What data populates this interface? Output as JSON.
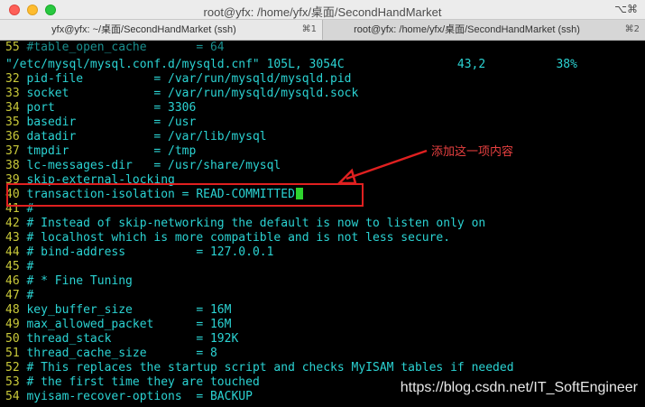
{
  "window": {
    "title": "root@yfx: /home/yfx/桌面/SecondHandMarket",
    "right_shortcut": "⌥⌘"
  },
  "tabs": [
    {
      "label": "yfx@yfx: ~/桌面/SecondHandMarket (ssh)",
      "shortcut": "⌘1",
      "active": true
    },
    {
      "label": "root@yfx: /home/yfx/桌面/SecondHandMarket (ssh)",
      "shortcut": "⌘2",
      "active": false
    }
  ],
  "editor": {
    "top_line": {
      "num": "55",
      "text": "#table_open_cache       = 64"
    },
    "status_line": "\"/etc/mysql/mysql.conf.d/mysqld.cnf\" 105L, 3054C                43,2          38%",
    "lines": [
      {
        "num": "32",
        "text": "pid-file          = /var/run/mysqld/mysqld.pid"
      },
      {
        "num": "33",
        "text": "socket            = /var/run/mysqld/mysqld.sock"
      },
      {
        "num": "34",
        "text": "port              = 3306"
      },
      {
        "num": "35",
        "text": "basedir           = /usr"
      },
      {
        "num": "36",
        "text": "datadir           = /var/lib/mysql"
      },
      {
        "num": "37",
        "text": "tmpdir            = /tmp"
      },
      {
        "num": "38",
        "text": "lc-messages-dir   = /usr/share/mysql"
      },
      {
        "num": "39",
        "text": "skip-external-locking"
      },
      {
        "num": "40",
        "text": "transaction-isolation = READ-COMMITTED"
      },
      {
        "num": "41",
        "text": "#"
      },
      {
        "num": "42",
        "text": "# Instead of skip-networking the default is now to listen only on"
      },
      {
        "num": "43",
        "text": "# localhost which is more compatible and is not less secure."
      },
      {
        "num": "44",
        "text": "# bind-address          = 127.0.0.1"
      },
      {
        "num": "45",
        "text": "#"
      },
      {
        "num": "46",
        "text": "# * Fine Tuning"
      },
      {
        "num": "47",
        "text": "#"
      },
      {
        "num": "48",
        "text": "key_buffer_size         = 16M"
      },
      {
        "num": "49",
        "text": "max_allowed_packet      = 16M"
      },
      {
        "num": "50",
        "text": "thread_stack            = 192K"
      },
      {
        "num": "51",
        "text": "thread_cache_size       = 8"
      },
      {
        "num": "52",
        "text": "# This replaces the startup script and checks MyISAM tables if needed"
      },
      {
        "num": "53",
        "text": "# the first time they are touched"
      },
      {
        "num": "54",
        "text": "myisam-recover-options  = BACKUP"
      }
    ]
  },
  "annotation": {
    "label": "添加这一项内容",
    "color": "#e02020"
  },
  "watermark": "https://blog.csdn.net/IT_SoftEngineer"
}
